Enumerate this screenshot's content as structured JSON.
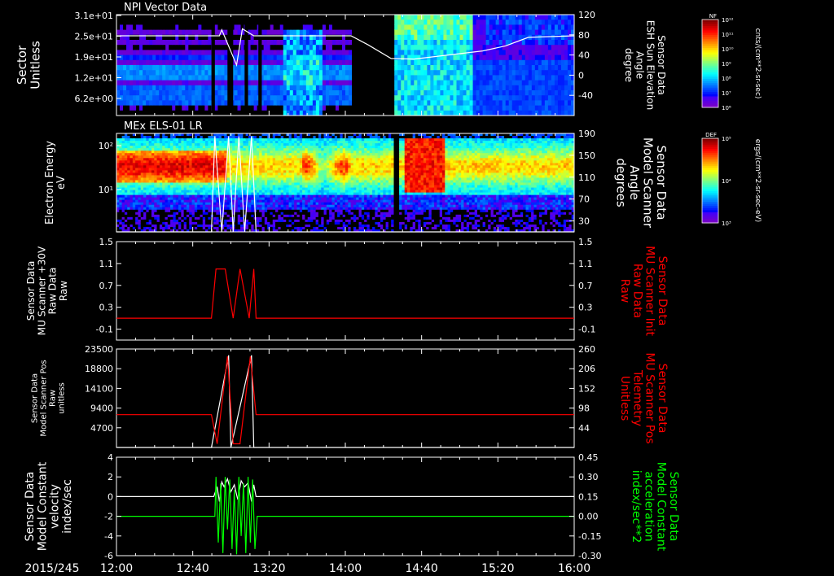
{
  "date_label": "2015/245",
  "time_axis": {
    "start": "12:00",
    "end": "16:00",
    "ticks": [
      "12:00",
      "12:40",
      "13:20",
      "14:00",
      "14:40",
      "15:20",
      "16:00"
    ]
  },
  "colors": {
    "background": "#000000",
    "foreground": "#ffffff",
    "red": "#ff0000",
    "green": "#00ff00"
  },
  "panels": [
    {
      "id": "npi",
      "title": "NPI Vector Data",
      "type": "spectrogram",
      "left_label": [
        "Sector",
        "Unitless"
      ],
      "left_ticks": [
        "3.1e+01",
        "2.5e+01",
        "1.9e+01",
        "1.2e+01",
        "6.2e+00"
      ],
      "right_label": [
        "Sensor Data",
        "ESH Sun Elevation",
        "Angle",
        "degree"
      ],
      "right_ticks": [
        "120",
        "80",
        "40",
        "0",
        "-40"
      ],
      "right_range": [
        -80,
        120
      ],
      "colorbar": {
        "title": "NF",
        "units": "cnts/(cm**2-sr-sec)",
        "labels": [
          "10¹²",
          "10¹¹",
          "10¹⁰",
          "10⁹",
          "10⁸",
          "10⁷",
          "10⁶"
        ]
      },
      "overlay_sun_elevation": {
        "t_hours": [
          0,
          0.9,
          0.92,
          1.05,
          1.1,
          1.2,
          2.05,
          2.2,
          2.4,
          2.6,
          3.2,
          3.4,
          3.6,
          4.0
        ],
        "deg": [
          78,
          78,
          90,
          20,
          92,
          78,
          78,
          60,
          33,
          32,
          48,
          58,
          75,
          78
        ]
      }
    },
    {
      "id": "els",
      "title": "MEx ELS-01 LR",
      "type": "spectrogram",
      "left_label": [
        "Electron Energy",
        "eV"
      ],
      "left_ticks": [
        "10²",
        "10¹"
      ],
      "right_label": [
        "Sensor Data",
        "Model Scanner",
        "Angle",
        "degrees"
      ],
      "right_ticks": [
        "190",
        "150",
        "110",
        "70",
        "30"
      ],
      "right_range": [
        10,
        190
      ],
      "colorbar": {
        "title": "DEF",
        "units": "ergs/(cm**2-sr-sec-eV)",
        "labels": [
          "10⁵",
          "10⁴",
          "10³"
        ]
      },
      "overlay_scanner_angle": {
        "t_hours": [
          0,
          0.83,
          0.86,
          0.92,
          0.98,
          1.02,
          1.07,
          1.12,
          1.18,
          1.22,
          1.26,
          4.0
        ],
        "deg": [
          10,
          10,
          185,
          10,
          185,
          10,
          185,
          10,
          185,
          10,
          10,
          10
        ]
      }
    },
    {
      "id": "raw",
      "type": "line",
      "left_label": [
        "Sensor Data",
        "MU Scanner +30V",
        "Raw Data",
        "Raw"
      ],
      "left_ticks": [
        "1.5",
        "1.1",
        "0.7",
        "0.3",
        "-0.1"
      ],
      "left_range": [
        -0.3,
        1.5
      ],
      "right_label": [
        "Sensor Data",
        "MU Scanner Init",
        "Raw Data",
        "Raw"
      ],
      "right_ticks": [
        "1.5",
        "1.1",
        "0.7",
        "0.3",
        "-0.1"
      ],
      "right_range": [
        -0.3,
        1.5
      ],
      "series": [
        {
          "color": "#ff0000",
          "t_hours": [
            0,
            0.83,
            0.87,
            0.95,
            1.02,
            1.08,
            1.16,
            1.2,
            1.22,
            4.0
          ],
          "v": [
            0.1,
            0.1,
            1.0,
            1.0,
            0.1,
            1.0,
            0.1,
            1.0,
            0.1,
            0.1
          ]
        }
      ]
    },
    {
      "id": "pos",
      "type": "line",
      "left_label": [
        "Sensor Data",
        "Model Scanner Pos",
        "Raw",
        "unitless"
      ],
      "left_ticks": [
        "23500",
        "18800",
        "14100",
        "9400",
        "4700"
      ],
      "left_range": [
        0,
        23500
      ],
      "right_label": [
        "Sensor Data",
        "MU Scanner Pos",
        "Telemetry",
        "Unitless"
      ],
      "right_ticks": [
        "260",
        "206",
        "152",
        "98",
        "44"
      ],
      "right_range": [
        -10,
        260
      ],
      "series": [
        {
          "color": "#ffffff",
          "axis": "left",
          "t_hours": [
            0,
            0.83,
            0.98,
            1.0,
            1.18,
            1.2,
            1.22,
            4.0
          ],
          "v": [
            0,
            0,
            22000,
            0,
            22000,
            0,
            0,
            0
          ]
        },
        {
          "color": "#ff0000",
          "axis": "right",
          "t_hours": [
            0,
            0.83,
            0.88,
            0.97,
            1.02,
            1.08,
            1.17,
            1.22,
            4.0
          ],
          "v": [
            80,
            80,
            0,
            240,
            0,
            0,
            240,
            80,
            80
          ]
        }
      ]
    },
    {
      "id": "vel",
      "type": "line",
      "left_label": [
        "Sensor Data",
        "Model Constant",
        "velocity",
        "index/sec"
      ],
      "left_ticks": [
        "4",
        "2",
        "0",
        "-2",
        "-4",
        "-6"
      ],
      "left_range": [
        -6,
        4
      ],
      "right_label": [
        "Sensor Data",
        "Model Constant",
        "acceleration",
        "index/sec**2"
      ],
      "right_ticks": [
        "0.45",
        "0.30",
        "0.15",
        "0.00",
        "-0.15",
        "-0.30"
      ],
      "right_range": [
        -0.3,
        0.45
      ],
      "series": [
        {
          "color": "#ffffff",
          "axis": "left",
          "t_hours": [
            0,
            0.85,
            0.88,
            0.9,
            0.92,
            0.94,
            0.97,
            1.0,
            1.03,
            1.06,
            1.09,
            1.12,
            1.15,
            1.18,
            1.2,
            1.22,
            4.0
          ],
          "v": [
            0,
            0,
            1.0,
            -0.5,
            1.5,
            1.0,
            1.8,
            0.5,
            1.2,
            -0.3,
            1.6,
            1.0,
            1.4,
            -0.5,
            1.2,
            0,
            0
          ]
        },
        {
          "color": "#00ff00",
          "axis": "right",
          "t_hours": [
            0,
            0.86,
            0.87,
            0.89,
            0.91,
            0.93,
            0.95,
            0.97,
            0.99,
            1.01,
            1.03,
            1.05,
            1.07,
            1.09,
            1.11,
            1.13,
            1.15,
            1.17,
            1.19,
            1.21,
            1.23,
            4.0
          ],
          "v": [
            0,
            0,
            0.3,
            -0.2,
            0.25,
            -0.28,
            0.3,
            -0.1,
            0.28,
            -0.25,
            0.2,
            -0.29,
            0.3,
            -0.15,
            0.25,
            -0.28,
            0.3,
            -0.2,
            0.28,
            -0.25,
            0,
            0
          ]
        }
      ]
    }
  ]
}
